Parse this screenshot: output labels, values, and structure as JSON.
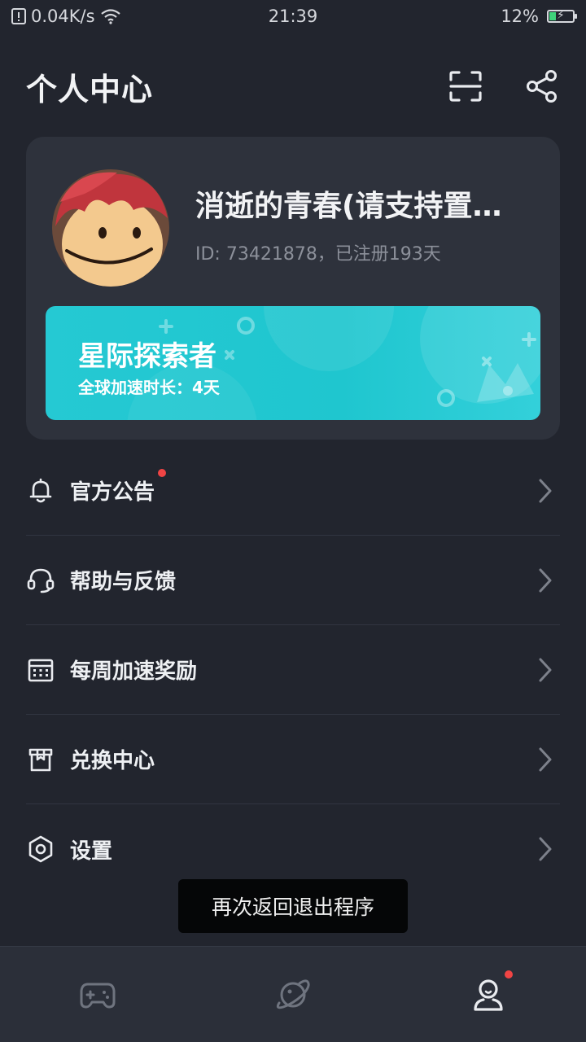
{
  "status_bar": {
    "net_speed": "0.04K/s",
    "time": "21:39",
    "battery": "12%",
    "battery_level": 0.12
  },
  "header": {
    "title": "个人中心",
    "scan_icon": "scan-icon",
    "share_icon": "share-icon"
  },
  "profile": {
    "username": "消逝的青春(请支持置…",
    "meta": "ID: 73421878，已注册193天",
    "vip": {
      "title": "星际探索者",
      "subtitle": "全球加速时长：4天"
    }
  },
  "menu": [
    {
      "label": "官方公告",
      "icon": "bell-icon",
      "badge": true
    },
    {
      "label": "帮助与反馈",
      "icon": "headset-icon",
      "badge": false
    },
    {
      "label": "每周加速奖励",
      "icon": "calendar-icon",
      "badge": false
    },
    {
      "label": "兑换中心",
      "icon": "gift-box-icon",
      "badge": false
    },
    {
      "label": "设置",
      "icon": "settings-hexagon-icon",
      "badge": false
    }
  ],
  "toast": "再次返回退出程序",
  "tabs": [
    {
      "icon": "gamepad-icon",
      "active": false
    },
    {
      "icon": "planet-icon",
      "active": false
    },
    {
      "icon": "user-icon",
      "active": true,
      "badge": true
    }
  ],
  "colors": {
    "background": "#22252e",
    "card": "#2e323c",
    "accent": "#25c9d3",
    "badge": "#f04444"
  }
}
